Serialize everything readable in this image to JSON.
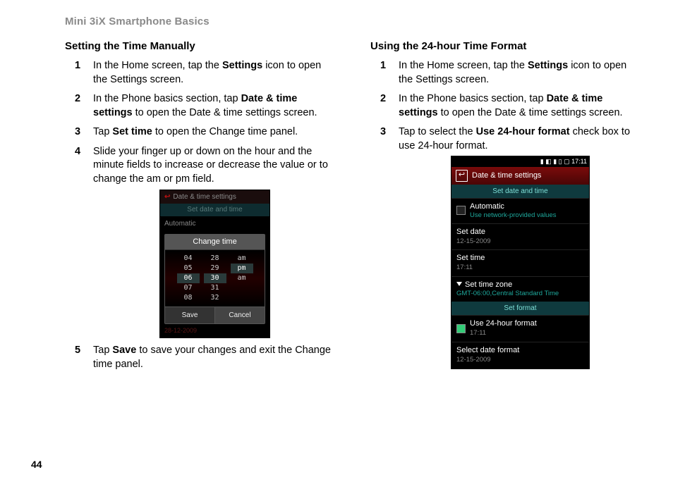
{
  "chapter_title": "Mini 3iX Smartphone Basics",
  "page_number": "44",
  "left": {
    "heading": "Setting the Time Manually",
    "steps": [
      {
        "pre": "In the Home screen, tap the ",
        "bold": "Settings",
        "post": " icon to open the Settings screen."
      },
      {
        "pre": "In the Phone basics section, tap ",
        "bold": "Date & time settings",
        "post": " to open the Date & time settings screen."
      },
      {
        "pre": "Tap ",
        "bold": "Set time",
        "post": " to open the Change time panel."
      },
      {
        "pre": "Slide your finger up or down on the hour and the minute fields to increase or decrease the value or to change the am or pm field.",
        "bold": "",
        "post": ""
      },
      {
        "pre": "Tap ",
        "bold": "Save",
        "post": " to save your changes and exit the Change time panel."
      }
    ],
    "phone": {
      "title_bar": "Date & time settings",
      "sub_1": "Set date and time",
      "automatic": "Automatic",
      "panel_title": "Change time",
      "hours": [
        "04",
        "05",
        "06",
        "07",
        "08"
      ],
      "minutes": [
        "28",
        "29",
        "30",
        "31",
        "32"
      ],
      "ampm": [
        "",
        "am",
        "pm",
        "",
        "am"
      ],
      "save": "Save",
      "cancel": "Cancel",
      "footer": "28-12-2009"
    }
  },
  "right": {
    "heading": "Using the 24-hour Time Format",
    "steps": [
      {
        "pre": "In the Home screen, tap the ",
        "bold": "Settings",
        "post": " icon to open the Settings screen."
      },
      {
        "pre": "In the Phone basics section, tap ",
        "bold": "Date & time settings",
        "post": " to open the Date & time settings screen."
      },
      {
        "pre": "Tap to select the ",
        "bold": "Use 24-hour format",
        "post": " check box to use 24-hour format."
      }
    ],
    "phone": {
      "status_time": "17:11",
      "title_bar": "Date & time settings",
      "section_1": "Set date and time",
      "automatic_t": "Automatic",
      "automatic_s": "Use network-provided values",
      "setdate_t": "Set date",
      "setdate_s": "12-15-2009",
      "settime_t": "Set time",
      "settime_s": "17:11",
      "stz_t": "Set time zone",
      "stz_s": "GMT-06:00,Central Standard Time",
      "section_2": "Set format",
      "u24_t": "Use 24-hour format",
      "u24_s": "17:11",
      "sdf_t": "Select date format",
      "sdf_s": "12-15-2009"
    }
  }
}
